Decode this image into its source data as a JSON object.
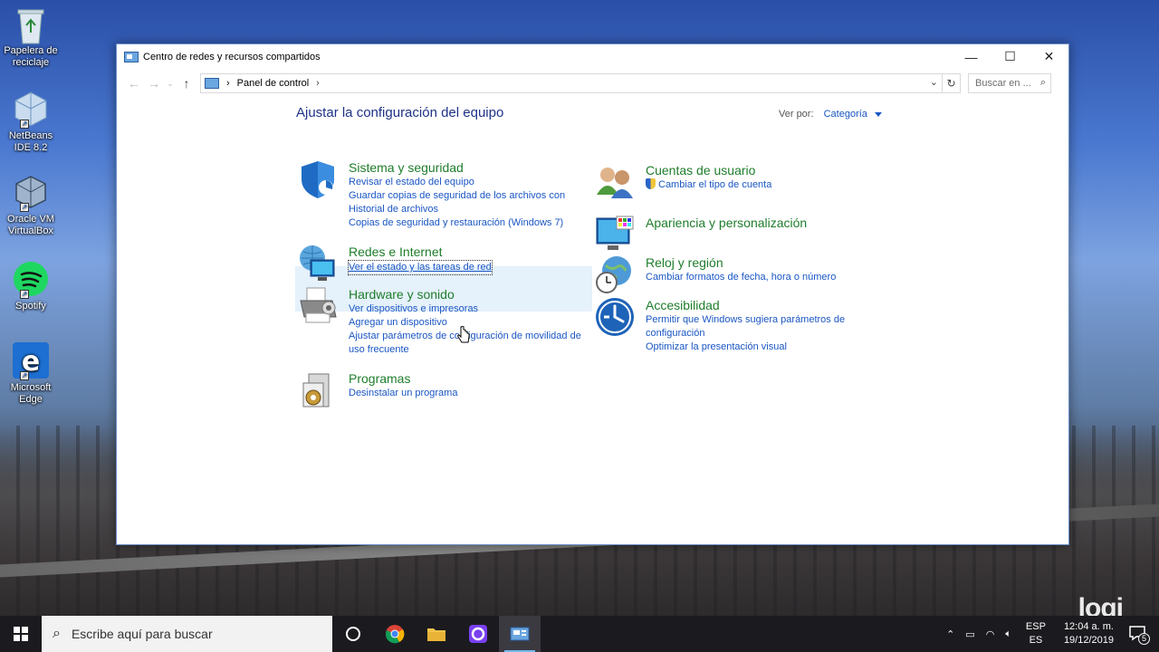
{
  "desktop": {
    "icons": [
      {
        "label": "Papelera de reciclaje"
      },
      {
        "label": "NetBeans IDE 8.2"
      },
      {
        "label": "Oracle VM VirtualBox"
      },
      {
        "label": "Spotify"
      },
      {
        "label": "Microsoft Edge"
      }
    ],
    "watermark": "logi"
  },
  "window": {
    "title": "Centro de redes y recursos compartidos",
    "address": {
      "crumb": "Panel de control",
      "separator": "›"
    },
    "search_placeholder": "Buscar en ...",
    "page_title": "Ajustar la configuración del equipo",
    "view_by": {
      "label": "Ver por:",
      "value": "Categoría"
    },
    "categories_left": [
      {
        "head": "Sistema y seguridad",
        "icon": "shield-icon",
        "links": [
          "Revisar el estado del equipo",
          "Guardar copias de seguridad de los archivos con Historial de archivos",
          "Copias de seguridad y restauración (Windows 7)"
        ]
      },
      {
        "head": "Redes e Internet",
        "icon": "network-globe-icon",
        "links": [
          "Ver el estado y las tareas de red"
        ]
      },
      {
        "head": "Hardware y sonido",
        "icon": "printer-icon",
        "links": [
          "Ver dispositivos e impresoras",
          "Agregar un dispositivo",
          "Ajustar parámetros de configuración de movilidad de uso frecuente"
        ]
      },
      {
        "head": "Programas",
        "icon": "programs-icon",
        "links": [
          "Desinstalar un programa"
        ]
      }
    ],
    "categories_right": [
      {
        "head": "Cuentas de usuario",
        "icon": "users-icon",
        "links": [
          "Cambiar el tipo de cuenta"
        ]
      },
      {
        "head": "Apariencia y personalización",
        "icon": "monitor-palette-icon",
        "links": []
      },
      {
        "head": "Reloj y región",
        "icon": "clock-globe-icon",
        "links": [
          "Cambiar formatos de fecha, hora o número"
        ]
      },
      {
        "head": "Accesibilidad",
        "icon": "accessibility-icon",
        "links": [
          "Permitir que Windows sugiera parámetros de configuración",
          "Optimizar la presentación visual"
        ]
      }
    ]
  },
  "taskbar": {
    "search_placeholder": "Escribe aquí para buscar",
    "lang_top": "ESP",
    "lang_bottom": "ES",
    "time": "12:04 a. m.",
    "date": "19/12/2019",
    "notifications": "5"
  }
}
